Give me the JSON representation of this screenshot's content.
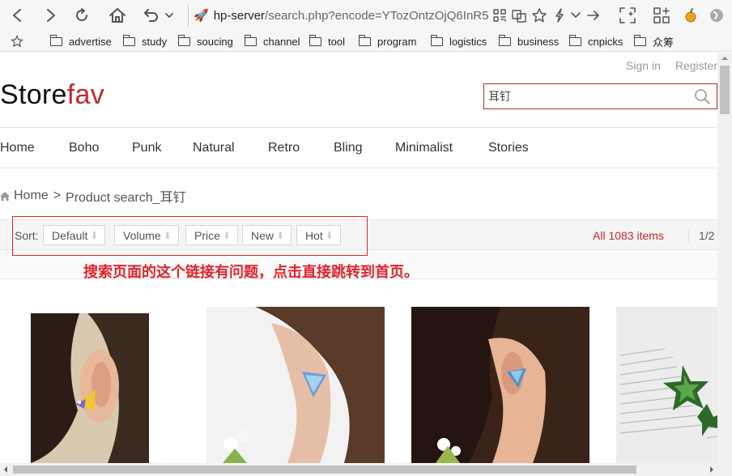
{
  "browser": {
    "url_host": "hp-server",
    "url_path": "/search.php?encode=YTozOntzOjQ6InR5",
    "bookmarks": [
      "advertise",
      "study",
      "soucing",
      "channel",
      "tool",
      "program",
      "logistics",
      "business",
      "cnpicks",
      "众筹"
    ]
  },
  "header": {
    "sign_in": "Sign in",
    "register": "Register",
    "logo_main": "Store",
    "logo_accent": "fav",
    "search_value": "耳钉"
  },
  "nav": [
    "Home",
    "Boho",
    "Punk",
    "Natural",
    "Retro",
    "Bling",
    "Minimalist",
    "Stories"
  ],
  "breadcrumb": {
    "home": "Home",
    "sep": ">",
    "current": "Product search_耳钉"
  },
  "sort": {
    "label": "Sort:",
    "options": [
      "Default",
      "Volume",
      "Price",
      "New",
      "Hot"
    ],
    "count": "All 1083 items",
    "pager": "1/2"
  },
  "annotation": "搜索页面的这个链接有问题，点击直接跳转到首页。",
  "colors": {
    "accent": "#c0282e",
    "annotation": "#e0242b"
  }
}
